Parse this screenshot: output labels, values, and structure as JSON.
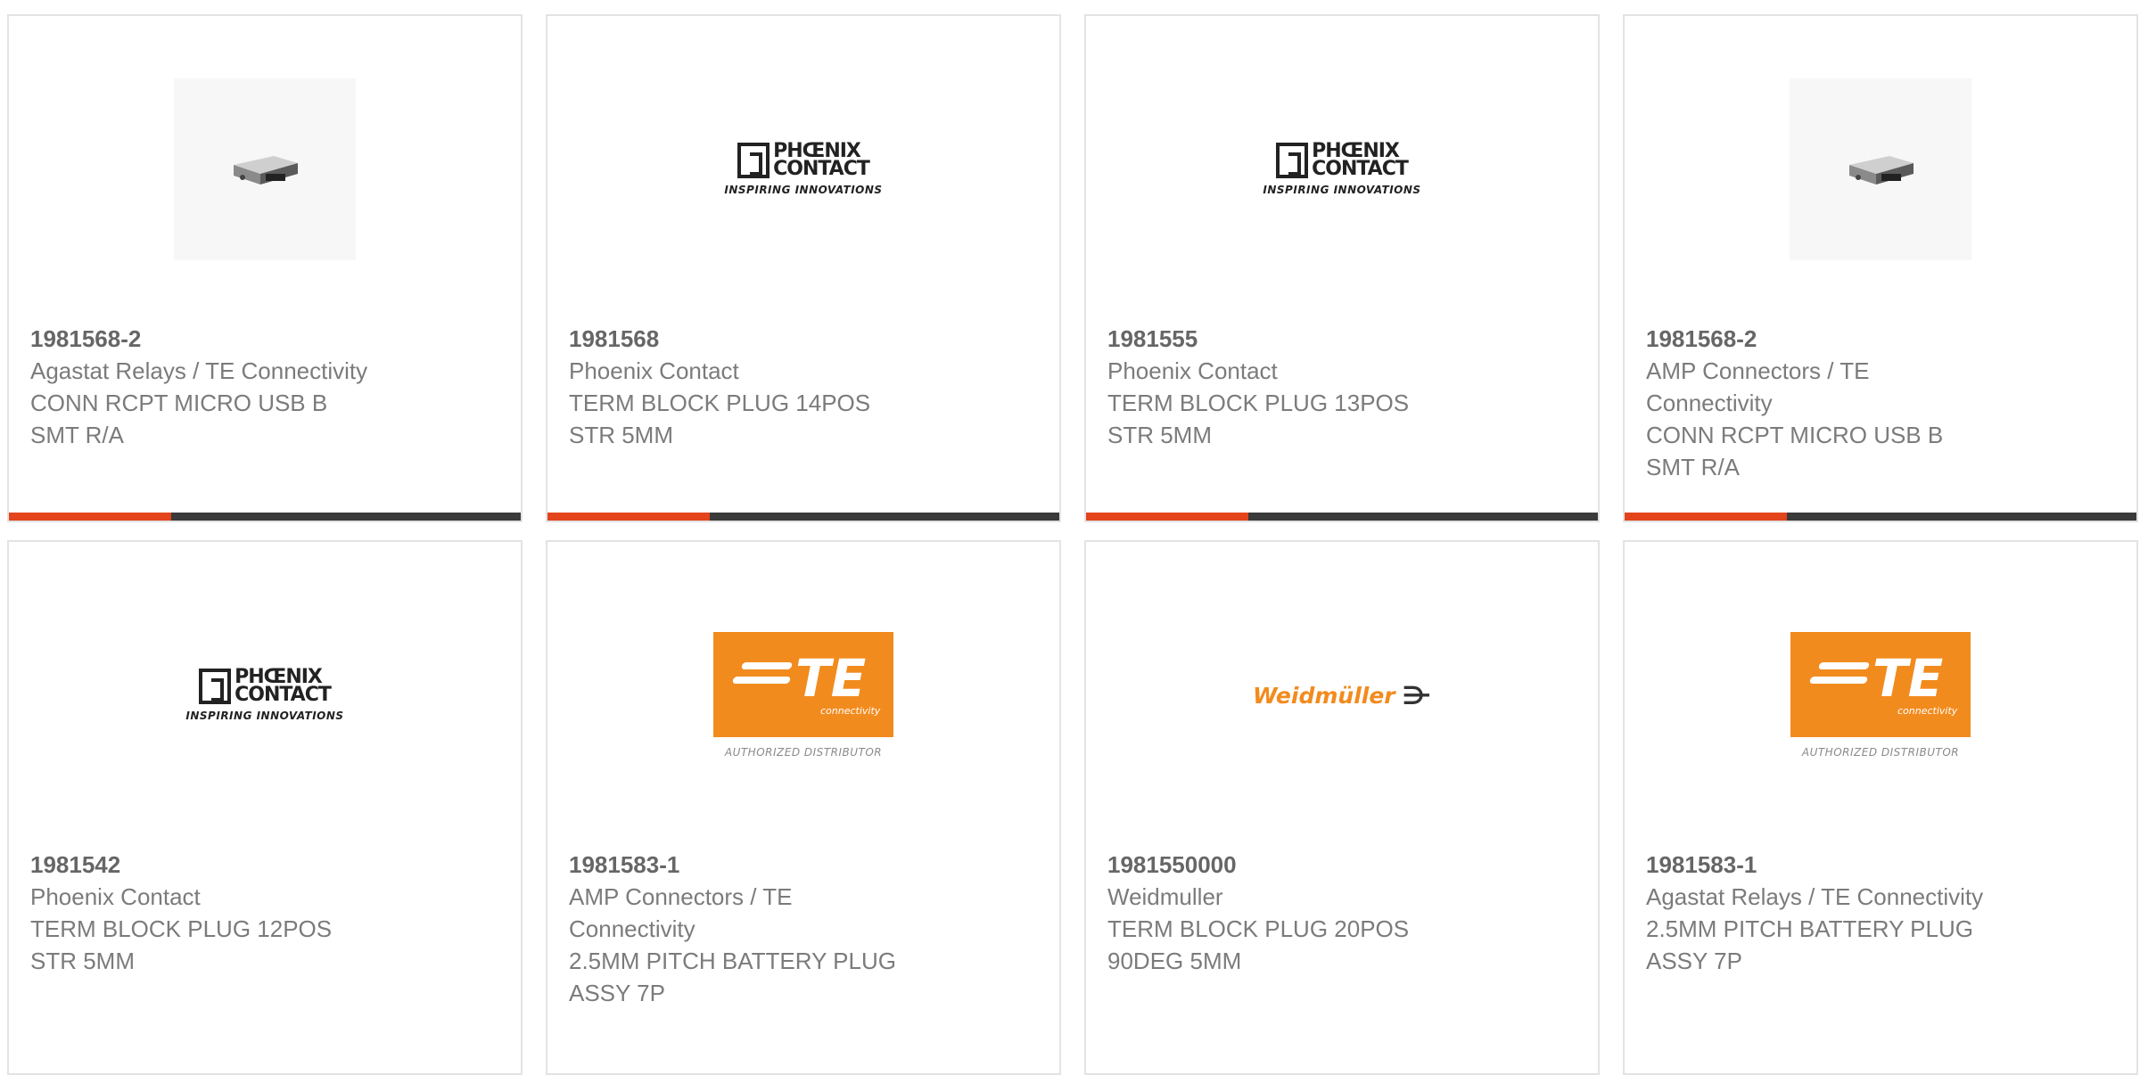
{
  "cards": [
    {
      "part": "1981568-2",
      "manufacturer": "Agastat Relays / TE Connectivity",
      "desc1": "CONN RCPT MICRO USB B",
      "desc2": "SMT R/A",
      "image": "usb-connector-photo"
    },
    {
      "part": "1981568",
      "manufacturer": "Phoenix Contact",
      "desc1": "TERM BLOCK PLUG 14POS",
      "desc2": "STR 5MM",
      "image": "phoenix-contact-logo"
    },
    {
      "part": "1981555",
      "manufacturer": "Phoenix Contact",
      "desc1": "TERM BLOCK PLUG 13POS",
      "desc2": "STR 5MM",
      "image": "phoenix-contact-logo"
    },
    {
      "part": "1981568-2",
      "manufacturer": "AMP Connectors / TE Connectivity",
      "desc1": "CONN RCPT MICRO USB B",
      "desc2": "SMT R/A",
      "image": "usb-connector-photo"
    },
    {
      "part": "1981542",
      "manufacturer": "Phoenix Contact",
      "desc1": "TERM BLOCK PLUG 12POS",
      "desc2": "STR 5MM",
      "image": "phoenix-contact-logo"
    },
    {
      "part": "1981583-1",
      "manufacturer": "AMP Connectors / TE Connectivity",
      "desc1": "2.5MM PITCH BATTERY PLUG",
      "desc2": "ASSY 7P",
      "image": "te-connectivity-logo"
    },
    {
      "part": "1981550000",
      "manufacturer": "Weidmuller",
      "desc1": "TERM BLOCK PLUG 20POS",
      "desc2": "90DEG 5MM",
      "image": "weidmuller-logo"
    },
    {
      "part": "1981583-1",
      "manufacturer": "Agastat Relays / TE Connectivity",
      "desc1": "2.5MM PITCH BATTERY PLUG",
      "desc2": "ASSY 7P",
      "image": "te-connectivity-logo"
    }
  ],
  "logos": {
    "phoenix_line1": "PHŒNIX",
    "phoenix_line2": "CONTACT",
    "phoenix_tag": "INSPIRING INNOVATIONS",
    "te_letters": "TE",
    "te_small": "connectivity",
    "te_auth": "AUTHORIZED DISTRIBUTOR",
    "weidmuller_text": "Weidmüller",
    "weidmuller_mark": "⋺"
  },
  "colors": {
    "accent": "#e3441c",
    "bar": "#3a3a3a",
    "te_orange": "#f28b1e",
    "text": "#7b7b7b"
  }
}
